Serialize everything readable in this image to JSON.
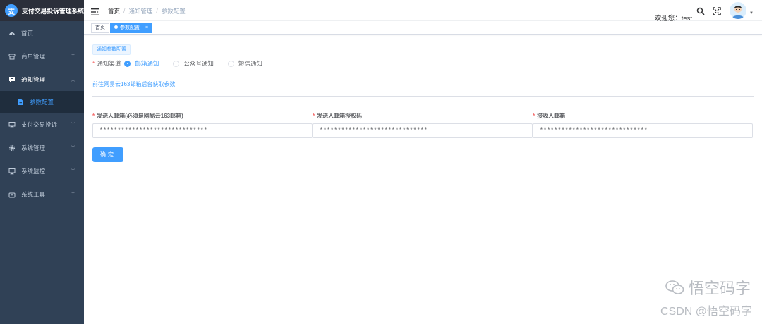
{
  "app": {
    "title": "支付交易投诉管理系统",
    "logo_char": "支"
  },
  "sidebar": {
    "items": [
      {
        "label": "首页",
        "icon": "dashboard-icon"
      },
      {
        "label": "商户管理",
        "icon": "merchant-icon",
        "chevron": "﹀"
      },
      {
        "label": "通知管理",
        "icon": "message-icon",
        "chevron": "︿"
      },
      {
        "label": "参数配置",
        "icon": "document-icon"
      },
      {
        "label": "支付交易投诉",
        "icon": "monitor-icon",
        "chevron": "﹀"
      },
      {
        "label": "系统管理",
        "icon": "gear-icon",
        "chevron": "﹀"
      },
      {
        "label": "系统监控",
        "icon": "monitor-icon",
        "chevron": "﹀"
      },
      {
        "label": "系统工具",
        "icon": "toolbox-icon",
        "chevron": "﹀"
      }
    ]
  },
  "header": {
    "breadcrumb": [
      "首页",
      "通知管理",
      "参数配置"
    ],
    "breadcrumb_sep": "/",
    "welcome": "欢迎您：test",
    "caret": "▼"
  },
  "tags": [
    {
      "label": "首页"
    },
    {
      "label": "参数配置",
      "close": "×"
    }
  ],
  "main": {
    "section_tag": "通知参数配置",
    "channel": {
      "required": "*",
      "label": "通知渠道",
      "options": [
        "邮箱通知",
        "公众号通知",
        "短信通知"
      ],
      "selected": "邮箱通知"
    },
    "link": "前往网易云163邮箱后台获取参数",
    "fields": [
      {
        "required": "*",
        "label": "发送人邮箱(必须是网易云163邮箱)",
        "value": "******************************"
      },
      {
        "required": "*",
        "label": "发送人邮箱授权码",
        "value": "******************************"
      },
      {
        "required": "*",
        "label": "接收人邮箱",
        "value": "******************************"
      }
    ],
    "confirm": "确定"
  },
  "watermark": {
    "line1": "悟空码字",
    "line2": "CSDN @悟空码字"
  },
  "colors": {
    "sidebar_bg": "#304156",
    "primary": "#409eff",
    "required": "#f56c6c"
  }
}
